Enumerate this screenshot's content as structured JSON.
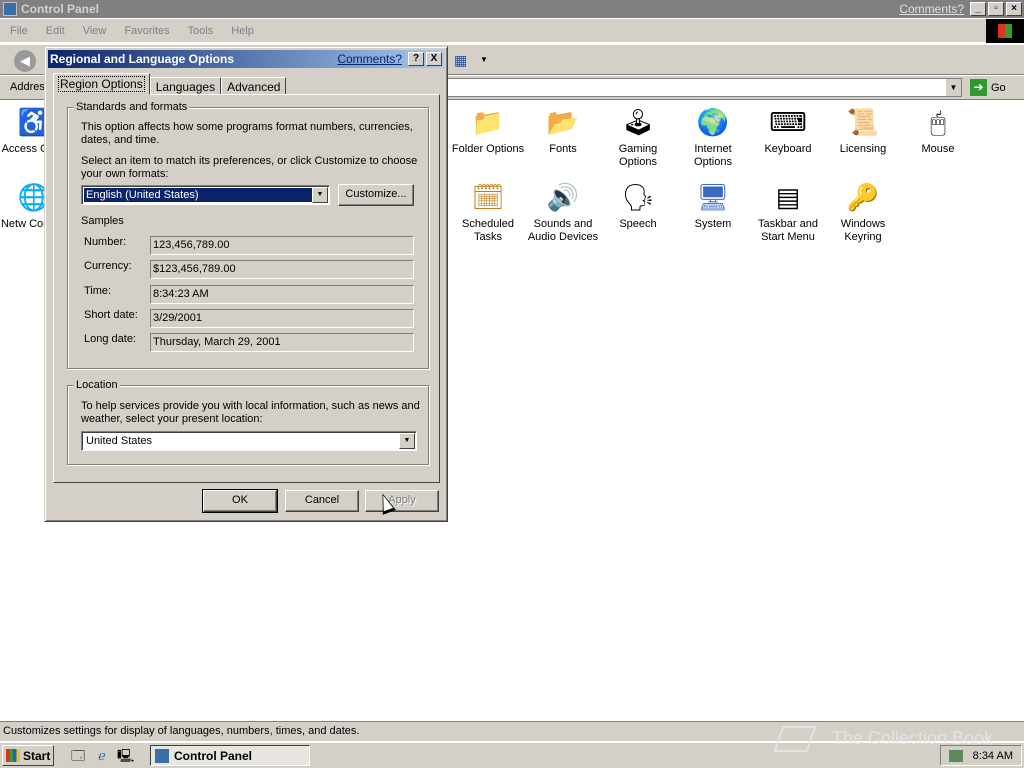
{
  "window": {
    "title": "Control Panel",
    "comments_link": "Comments?",
    "menu": [
      "File",
      "Edit",
      "View",
      "Favorites",
      "Tools",
      "Help"
    ],
    "address_label": "Addres",
    "go_label": "Go"
  },
  "control_panel_items": [
    {
      "label": "Access Optio",
      "icon": "accessibility-icon"
    },
    {
      "label": "Netw Connec",
      "icon": "network-icon"
    },
    {
      "label": "Folder Options",
      "icon": "folder-icon"
    },
    {
      "label": "Fonts",
      "icon": "fonts-icon"
    },
    {
      "label": "Gaming Options",
      "icon": "joystick-icon"
    },
    {
      "label": "Internet Options",
      "icon": "globe-icon"
    },
    {
      "label": "Keyboard",
      "icon": "keyboard-icon"
    },
    {
      "label": "Licensing",
      "icon": "certificate-icon"
    },
    {
      "label": "Mouse",
      "icon": "mouse-icon"
    },
    {
      "label": "Scheduled Tasks",
      "icon": "scheduled-tasks-icon"
    },
    {
      "label": "Sounds and Audio Devices",
      "icon": "speaker-icon"
    },
    {
      "label": "Speech",
      "icon": "speech-icon"
    },
    {
      "label": "System",
      "icon": "system-icon"
    },
    {
      "label": "Taskbar and Start Menu",
      "icon": "taskbar-icon"
    },
    {
      "label": "Windows Keyring",
      "icon": "keyring-icon"
    }
  ],
  "statusbar": {
    "text": "Customizes settings for display of languages, numbers, times, and dates."
  },
  "taskbar": {
    "start_label": "Start",
    "task_label": "Control Panel",
    "clock": "8:34 AM",
    "watermark": "The Collection Book"
  },
  "dialog": {
    "title": "Regional and Language Options",
    "comments_link": "Comments?",
    "help_btn": "?",
    "close_btn": "X",
    "tabs": [
      "Region Options",
      "Languages",
      "Advanced"
    ],
    "standards": {
      "legend": "Standards and formats",
      "description": "This option affects how some programs format numbers, currencies, dates, and time.",
      "select_prompt": "Select an item to match its preferences, or click Customize to choose your own formats:",
      "selected_format": "English (United States)",
      "customize_label": "Customize..."
    },
    "samples": {
      "heading": "Samples",
      "rows": [
        {
          "label": "Number:",
          "value": "123,456,789.00"
        },
        {
          "label": "Currency:",
          "value": "$123,456,789.00"
        },
        {
          "label": "Time:",
          "value": "8:34:23 AM"
        },
        {
          "label": "Short date:",
          "value": "3/29/2001"
        },
        {
          "label": "Long date:",
          "value": "Thursday, March 29, 2001"
        }
      ]
    },
    "location": {
      "legend": "Location",
      "description": "To help services provide you with local information, such as news and weather, select your present location:",
      "selected": "United States"
    },
    "buttons": {
      "ok": "OK",
      "cancel": "Cancel",
      "apply": "Apply"
    }
  }
}
